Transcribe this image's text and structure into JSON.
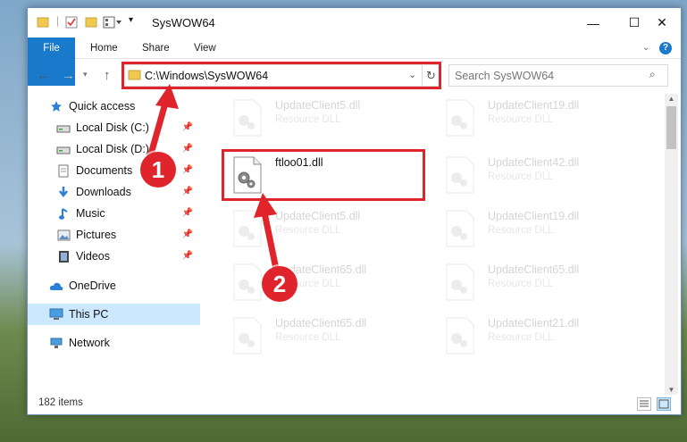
{
  "window": {
    "title": "SysWOW64",
    "controls": {
      "minimize": "—",
      "maximize": "☐",
      "close": "✕"
    }
  },
  "ribbon": {
    "tabs": [
      {
        "label": "File"
      },
      {
        "label": "Home"
      },
      {
        "label": "Share"
      },
      {
        "label": "View"
      }
    ]
  },
  "navbar": {
    "address": "C:\\Windows\\SysWOW64",
    "search_placeholder": "Search SysWOW64"
  },
  "sidebar": {
    "items": [
      {
        "label": "Quick access",
        "icon": "star-icon"
      },
      {
        "label": "Local Disk (C:)",
        "icon": "drive-icon",
        "pinned": true
      },
      {
        "label": "Local Disk (D:)",
        "icon": "drive-icon",
        "pinned": true
      },
      {
        "label": "Documents",
        "icon": "documents-icon",
        "pinned": true
      },
      {
        "label": "Downloads",
        "icon": "download-icon",
        "pinned": true
      },
      {
        "label": "Music",
        "icon": "music-icon",
        "pinned": true
      },
      {
        "label": "Pictures",
        "icon": "pictures-icon",
        "pinned": true
      },
      {
        "label": "Videos",
        "icon": "videos-icon",
        "pinned": true
      },
      {
        "label": "OneDrive",
        "icon": "cloud-icon"
      },
      {
        "label": "This PC",
        "icon": "computer-icon",
        "selected": true
      },
      {
        "label": "Network",
        "icon": "network-icon"
      }
    ]
  },
  "files": [
    {
      "name": "UpdateClient5.dll",
      "type": "Resource DLL",
      "faded": true
    },
    {
      "name": "UpdateClient19.dll",
      "type": "Resource DLL",
      "faded": true
    },
    {
      "name": "ftloo01.dll",
      "type": "",
      "faded": false,
      "highlighted": true
    },
    {
      "name": "UpdateClient42.dll",
      "type": "Resource DLL",
      "faded": true
    },
    {
      "name": "UpdateClient5.dll",
      "type": "Resource DLL",
      "faded": true
    },
    {
      "name": "UpdateClient19.dll",
      "type": "Resource DLL",
      "faded": true
    },
    {
      "name": "UpdateClient65.dll",
      "type": "Resource DLL",
      "faded": true
    },
    {
      "name": "UpdateClient65.dll",
      "type": "Resource DLL",
      "faded": true
    },
    {
      "name": "UpdateClient65.dll",
      "type": "Resource DLL",
      "faded": true
    },
    {
      "name": "UpdateClient21.dll",
      "type": "Resource DLL",
      "faded": true
    }
  ],
  "status": {
    "item_count": "182 items"
  },
  "callouts": [
    {
      "number": "1"
    },
    {
      "number": "2"
    }
  ],
  "colors": {
    "accent": "#1979ca",
    "highlight": "#e0242b",
    "selected": "#cce8ff"
  }
}
